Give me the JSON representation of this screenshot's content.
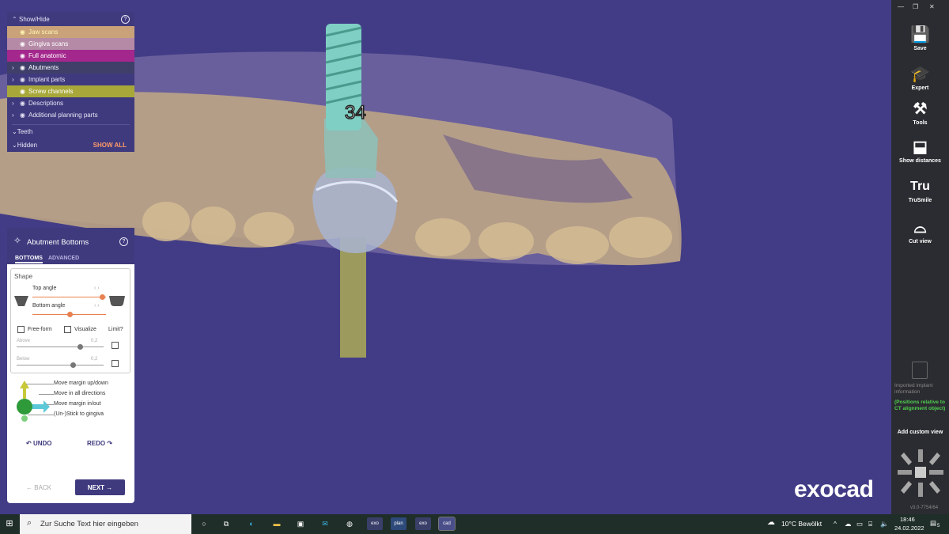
{
  "show_hide": {
    "title": "Show/Hide",
    "rows": [
      {
        "label": "Jaw scans"
      },
      {
        "label": "Gingiva scans"
      },
      {
        "label": "Full anatomic"
      },
      {
        "label": "Abutments"
      },
      {
        "label": "Implant parts"
      },
      {
        "label": "Screw channels"
      },
      {
        "label": "Descriptions"
      },
      {
        "label": "Additional planning parts"
      }
    ],
    "teeth": "Teeth",
    "hidden": "Hidden",
    "show_all": "SHOW ALL"
  },
  "abutment_panel": {
    "title": "Abutment Bottoms",
    "tab_bottoms": "BOTTOMS",
    "tab_advanced": "ADVANCED",
    "shape_label": "Shape",
    "top_angle": "Top angle",
    "bottom_angle": "Bottom angle",
    "top_angle_level": 0.95,
    "bottom_angle_level": 0.5,
    "free_form": "Free-form",
    "visualize": "Visualize",
    "limit": "Limit?",
    "above": "Above",
    "above_value": "0,2",
    "below": "Below",
    "below_value": "0,2",
    "legend": [
      "Move margin up/down",
      "Move in all directions",
      "Move margin in/out",
      "(Un-)Stick to gingiva"
    ],
    "undo": "UNDO",
    "redo": "REDO",
    "back": "BACK",
    "next": "NEXT"
  },
  "tooth_number": "34",
  "brand": "exocad",
  "toolbar": {
    "save": "Save",
    "expert": "Expert",
    "tools": "Tools",
    "show_distances": "Show distances",
    "trusmile_icon_text": "Tru",
    "trusmile": "TruSmile",
    "cut_view": "Cut view",
    "imported_info": "Imported implant information",
    "positions_note": "(Positions relative to CT alignment object)",
    "add_custom_view": "Add custom view",
    "version": "v3.0-7754/64"
  },
  "taskbar": {
    "search_placeholder": "Zur Suche Text hier eingeben",
    "apps": [
      "exo",
      "plan",
      "exo",
      "cad"
    ],
    "weather": "10°C  Bewölkt",
    "time": "18:46",
    "date": "24.02.2022",
    "notifications": "5"
  },
  "colors": {
    "viewport_bg": "#423c86",
    "panel_bg": "#3f3a7e",
    "accent_orange": "#e8804f",
    "screw_channel": "#a8a83a",
    "full_anatomic": "#a3278c"
  }
}
